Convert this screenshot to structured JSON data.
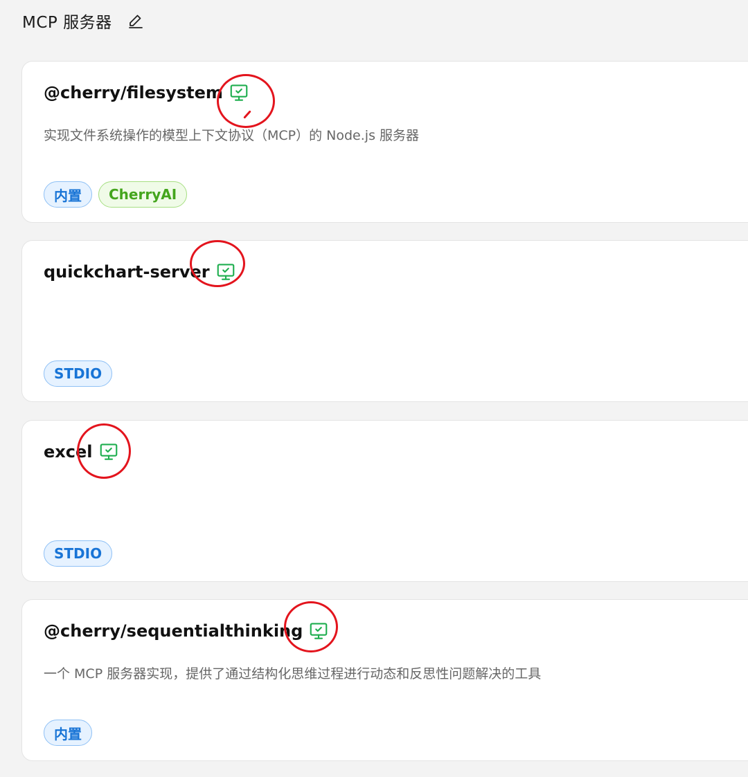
{
  "header": {
    "title": "MCP 服务器",
    "edit_icon": "pencil-edit-icon"
  },
  "colors": {
    "accent_green": "#1fae4f",
    "tag_blue": "#1874d6",
    "tag_green": "#44a51d",
    "annotation_red": "#e3141d"
  },
  "servers": [
    {
      "name": "@cherry/filesystem",
      "status_icon": "monitor-check-icon",
      "description": "实现文件系统操作的模型上下文协议（MCP）的 Node.js 服务器",
      "tags": [
        "内置",
        "CherryAI"
      ]
    },
    {
      "name": "quickchart-server",
      "status_icon": "monitor-check-icon",
      "description": "",
      "tags": [
        "STDIO"
      ]
    },
    {
      "name": "excel",
      "status_icon": "monitor-check-icon",
      "description": "",
      "tags": [
        "STDIO"
      ]
    },
    {
      "name": "@cherry/sequentialthinking",
      "status_icon": "monitor-check-icon",
      "description": "一个 MCP 服务器实现，提供了通过结构化思维过程进行动态和反思性问题解决的工具",
      "tags": [
        "内置"
      ]
    }
  ]
}
